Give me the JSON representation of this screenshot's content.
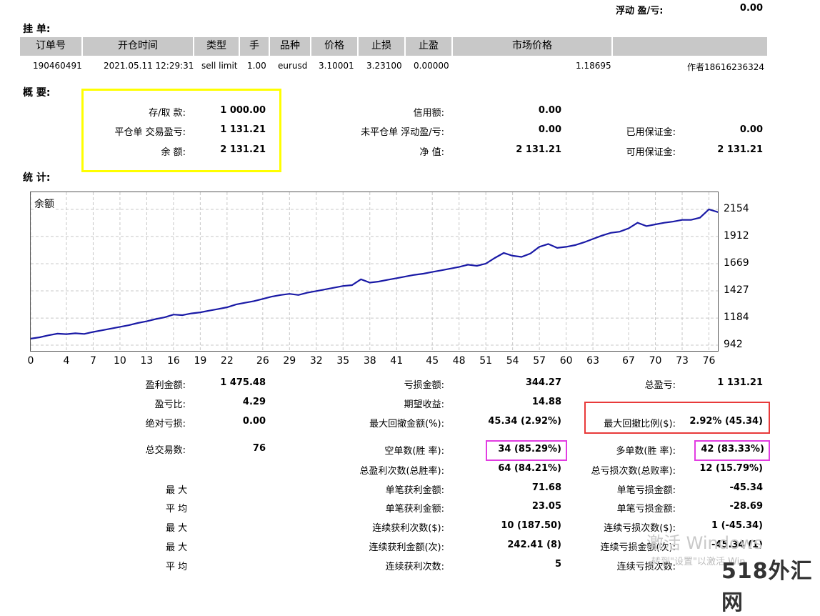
{
  "floating": {
    "label": "浮动 盈/亏:",
    "value": "0.00"
  },
  "pending": {
    "title": "挂 单:",
    "headers": [
      "订单号",
      "开仓时间",
      "类型",
      "手",
      "品种",
      "价格",
      "止损",
      "止盈",
      "市场价格",
      ""
    ],
    "row": {
      "order": "190460491",
      "time": "2021.05.11 12:29:31",
      "type": "sell limit",
      "lots": "1.00",
      "symbol": "eurusd",
      "price": "3.10001",
      "sl": "3.23100",
      "tp": "0.00000",
      "market": "1.18695",
      "comment": "作者18616236324"
    }
  },
  "summary": {
    "title": "概 要:",
    "deposit_label": "存/取 款:",
    "deposit": "1 000.00",
    "closed_pl_label": "平仓单 交易盈亏:",
    "closed_pl": "1 131.21",
    "balance_label": "余 额:",
    "balance": "2 131.21",
    "credit_label": "信用额:",
    "credit": "0.00",
    "open_pl_label": "未平仓单 浮动盈/亏:",
    "open_pl": "0.00",
    "equity_label": "净 值:",
    "equity": "2 131.21",
    "margin_label": "已用保证金:",
    "margin": "0.00",
    "free_margin_label": "可用保证金:",
    "free_margin": "2 131.21"
  },
  "stats_title": "统 计:",
  "chart_data": {
    "type": "line",
    "title": "余额",
    "x_ticks": [
      "0",
      "4",
      "7",
      "10",
      "13",
      "16",
      "19",
      "22",
      "26",
      "29",
      "32",
      "35",
      "38",
      "41",
      "45",
      "48",
      "51",
      "54",
      "57",
      "60",
      "63",
      "67",
      "70",
      "73",
      "76"
    ],
    "y_ticks": [
      "2154",
      "1912",
      "1669",
      "1427",
      "1184",
      "942"
    ],
    "ylim": [
      942,
      2154
    ],
    "xlim": [
      0,
      77
    ],
    "grid": true,
    "series": [
      {
        "values": [
          1000,
          1012,
          1030,
          1045,
          1040,
          1048,
          1042,
          1060,
          1075,
          1090,
          1105,
          1120,
          1140,
          1155,
          1175,
          1190,
          1215,
          1210,
          1225,
          1235,
          1250,
          1265,
          1280,
          1305,
          1320,
          1335,
          1355,
          1375,
          1390,
          1400,
          1390,
          1410,
          1425,
          1440,
          1455,
          1470,
          1478,
          1530,
          1500,
          1510,
          1525,
          1540,
          1555,
          1570,
          1580,
          1595,
          1610,
          1625,
          1640,
          1660,
          1650,
          1670,
          1720,
          1765,
          1740,
          1730,
          1760,
          1820,
          1845,
          1810,
          1820,
          1835,
          1860,
          1890,
          1920,
          1945,
          1955,
          1985,
          2035,
          2005,
          2020,
          2035,
          2045,
          2060,
          2060,
          2080,
          2154,
          2130,
          2131
        ]
      }
    ],
    "line_color": "#1a1aa6"
  },
  "stats": {
    "gross_profit_label": "盈利金额:",
    "gross_profit": "1 475.48",
    "gross_loss_label": "亏损金额:",
    "gross_loss": "344.27",
    "total_pl_label": "总盈亏:",
    "total_pl": "1 131.21",
    "profit_factor_label": "盈亏比:",
    "profit_factor": "4.29",
    "expected_label": "期望收益:",
    "expected": "14.88",
    "abs_dd_label": "绝对亏损:",
    "abs_dd": "0.00",
    "max_dd_label": "最大回撤金额(%):",
    "max_dd": "45.34 (2.92%)",
    "rel_dd_label": "最大回撤比例($):",
    "rel_dd": "2.92% (45.34)",
    "total_trades_label": "总交易数:",
    "total_trades": "76",
    "short_label": "空单数(胜 率):",
    "short": "34 (85.29%)",
    "long_label": "多单数(胜 率):",
    "long": "42 (83.33%)",
    "win_count_label": "总盈利次数(总胜率):",
    "win_count": "64 (84.21%)",
    "loss_count_label": "总亏损次数(总败率):",
    "loss_count": "12 (15.79%)",
    "max_label": "最 大",
    "avg_label": "平 均",
    "max_win_label": "单笔获利金额:",
    "max_win": "71.68",
    "max_loss_label": "单笔亏损金额:",
    "max_loss": "-45.34",
    "avg_win_label": "单笔获利金额:",
    "avg_win": "23.05",
    "avg_loss_label": "单笔亏损金额:",
    "avg_loss": "-28.69",
    "cons_wins_label": "连续获利次数($):",
    "cons_wins": "10 (187.50)",
    "cons_losses_label": "连续亏损次数($):",
    "cons_losses": "1 (-45.34)",
    "cons_profit_label": "连续获利金额(次):",
    "cons_profit": "242.41 (8)",
    "cons_loss_label": "连续亏损金额(次):",
    "cons_loss": "-45.34 (1)",
    "avg_cons_wins_label": "连续获利次数:",
    "avg_cons_wins": "5",
    "avg_cons_losses_label": "连续亏损次数:"
  },
  "watermark": {
    "line1": "激活 Windows",
    "line2": "转到\"设置\"以激活 Win",
    "logo": "518外汇网"
  },
  "colors": {
    "yellow_box": "#ffff00",
    "red_box": "#e83a3a",
    "magenta_box": "#e23ce2",
    "header_bg": "#c8c8c8"
  }
}
